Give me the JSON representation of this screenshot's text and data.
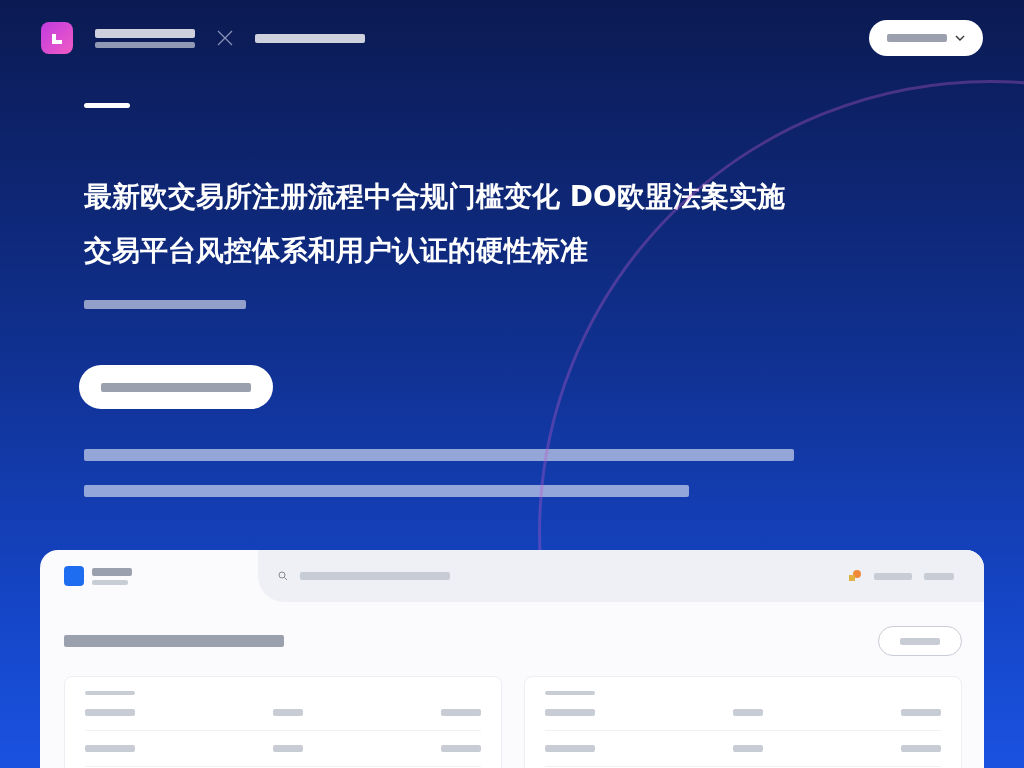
{
  "hero": {
    "headline_lines": [
      "最新欧交易所注册流程中合规门槛变化 DO欧盟法案实施",
      "交易平台风控体系和用户认证的硬性标准"
    ]
  }
}
